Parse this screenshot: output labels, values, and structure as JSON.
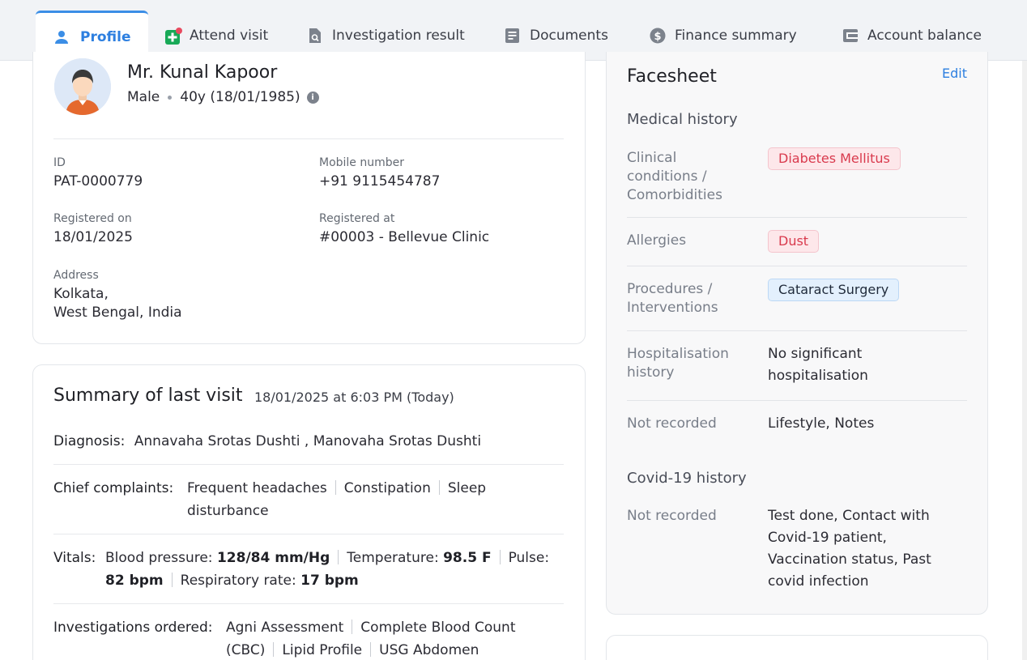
{
  "tabs": [
    {
      "label": "Profile",
      "icon": "person-icon"
    },
    {
      "label": "Attend visit",
      "icon": "medical-plus-icon"
    },
    {
      "label": "Investigation result",
      "icon": "search-document-icon"
    },
    {
      "label": "Documents",
      "icon": "document-icon"
    },
    {
      "label": "Finance summary",
      "icon": "dollar-icon"
    },
    {
      "label": "Account balance",
      "icon": "wallet-icon"
    }
  ],
  "patient": {
    "name": "Mr. Kunal Kapoor",
    "gender": "Male",
    "age_dob": "40y (18/01/1985)",
    "id_label": "ID",
    "id": "PAT-0000779",
    "mobile_label": "Mobile number",
    "mobile": "+91 9115454787",
    "registered_on_label": "Registered on",
    "registered_on": "18/01/2025",
    "registered_at_label": "Registered at",
    "registered_at": "#00003 - Bellevue Clinic",
    "address_label": "Address",
    "address_line1": "Kolkata,",
    "address_line2": "West Bengal, India"
  },
  "summary": {
    "title": "Summary of last visit",
    "time": "18/01/2025 at 6:03 PM (Today)",
    "diagnosis_label": "Diagnosis:",
    "diagnosis": "Annavaha Srotas Dushti , Manovaha Srotas Dushti",
    "complaints_label": "Chief complaints:",
    "complaints": [
      "Frequent headaches",
      "Constipation",
      "Sleep",
      "disturbance"
    ],
    "vitals_label": "Vitals:",
    "vitals": {
      "bp_label": "Blood pressure:",
      "bp": "128/84 mm/Hg",
      "temp_label": "Temperature:",
      "temp": "98.5 F",
      "pulse_label": "Pulse:",
      "pulse": "82 bpm",
      "resp_label": "Respiratory rate:",
      "resp": "17 bpm"
    },
    "investigations_label": "Investigations ordered:",
    "investigations": [
      "Agni Assessment",
      "Complete Blood Count",
      "(CBC)",
      "Lipid Profile",
      "USG Abdomen"
    ]
  },
  "facesheet": {
    "title": "Facesheet",
    "edit": "Edit",
    "medical_history": "Medical history",
    "conditions_label": "Clinical conditions / Comorbidities",
    "conditions": "Diabetes Mellitus",
    "allergies_label": "Allergies",
    "allergies": "Dust",
    "procedures_label": "Procedures / Interventions",
    "procedures": "Cataract Surgery",
    "hospitalisation_label": "Hospitalisation history",
    "hospitalisation": "No significant hospitalisation",
    "not_recorded_1": "Not recorded",
    "not_recorded_1_val": "Lifestyle, Notes",
    "covid_history": "Covid-19 history",
    "not_recorded_2": "Not recorded",
    "not_recorded_2_val": "Test done, Contact with Covid-19 patient, Vaccination status, Past covid infection"
  },
  "colors": {
    "accent": "#2d7fe0",
    "chip_red": "#d93a4d",
    "chip_blue_bg": "#e3f0fd"
  }
}
